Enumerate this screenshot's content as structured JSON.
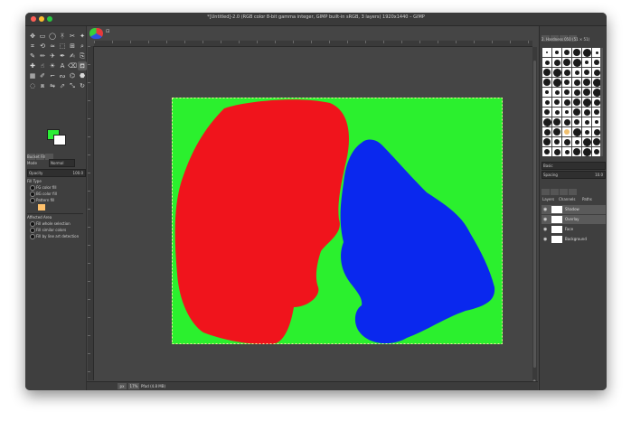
{
  "window": {
    "title": "*[Untitled]-2.0 (RGB color 8-bit gamma integer, GIMP built-in sRGB, 3 layers) 1920x1440 – GIMP"
  },
  "toolbox": {
    "tools": [
      "move",
      "rect-select",
      "ellipse-select",
      "free-select",
      "scissors",
      "fuzzy-select",
      "crop",
      "unified-transform",
      "warp",
      "handle-transform",
      "align",
      "zoom",
      "paintbrush",
      "pencil",
      "airbrush",
      "ink",
      "mypaint",
      "clone",
      "heal",
      "smudge",
      "dodge",
      "text",
      "eraser",
      "bucket-fill",
      "gradient",
      "color-picker",
      "measure",
      "path",
      "cage",
      "foreground-select",
      "blur",
      "perspective",
      "flip",
      "shear",
      "scale",
      "rotate"
    ],
    "fg_color": "#2bee36",
    "bg_color": "#ffffff",
    "options_title": "Bucket Fill",
    "mode_label": "Mode",
    "mode_value": "Normal",
    "opacity_label": "Opacity",
    "opacity_value": "100.0",
    "fill_type_label": "Fill Type",
    "fill_options": [
      "FG color fill",
      "BG color fill",
      "Pattern fill"
    ],
    "affected_area_label": "Affected Area",
    "area_options": [
      "Fill whole selection",
      "Fill similar colors",
      "Fill by line art detection"
    ],
    "pattern_color": "#ffc16b"
  },
  "image": {
    "status_unit": "px",
    "status_zoom": "17%",
    "status_info": "Pfad (4.8 MB)"
  },
  "canvas_colors": {
    "background": "#2bf02e",
    "red": "#f0141c",
    "blue": "#0a28ee"
  },
  "dock": {
    "brush_header": "2. Hardness 050 (51 × 51)",
    "brush_filter": "Basic",
    "brush_spacing_label": "Spacing",
    "brush_spacing_value": "10.0",
    "layers_tab": "Layers",
    "channels_tab": "Channels",
    "paths_tab": "Paths",
    "layers": [
      {
        "name": "Shadow",
        "selected": true
      },
      {
        "name": "Overlay",
        "selected": true
      },
      {
        "name": "Face",
        "selected": false
      },
      {
        "name": "Background",
        "selected": false
      }
    ]
  }
}
